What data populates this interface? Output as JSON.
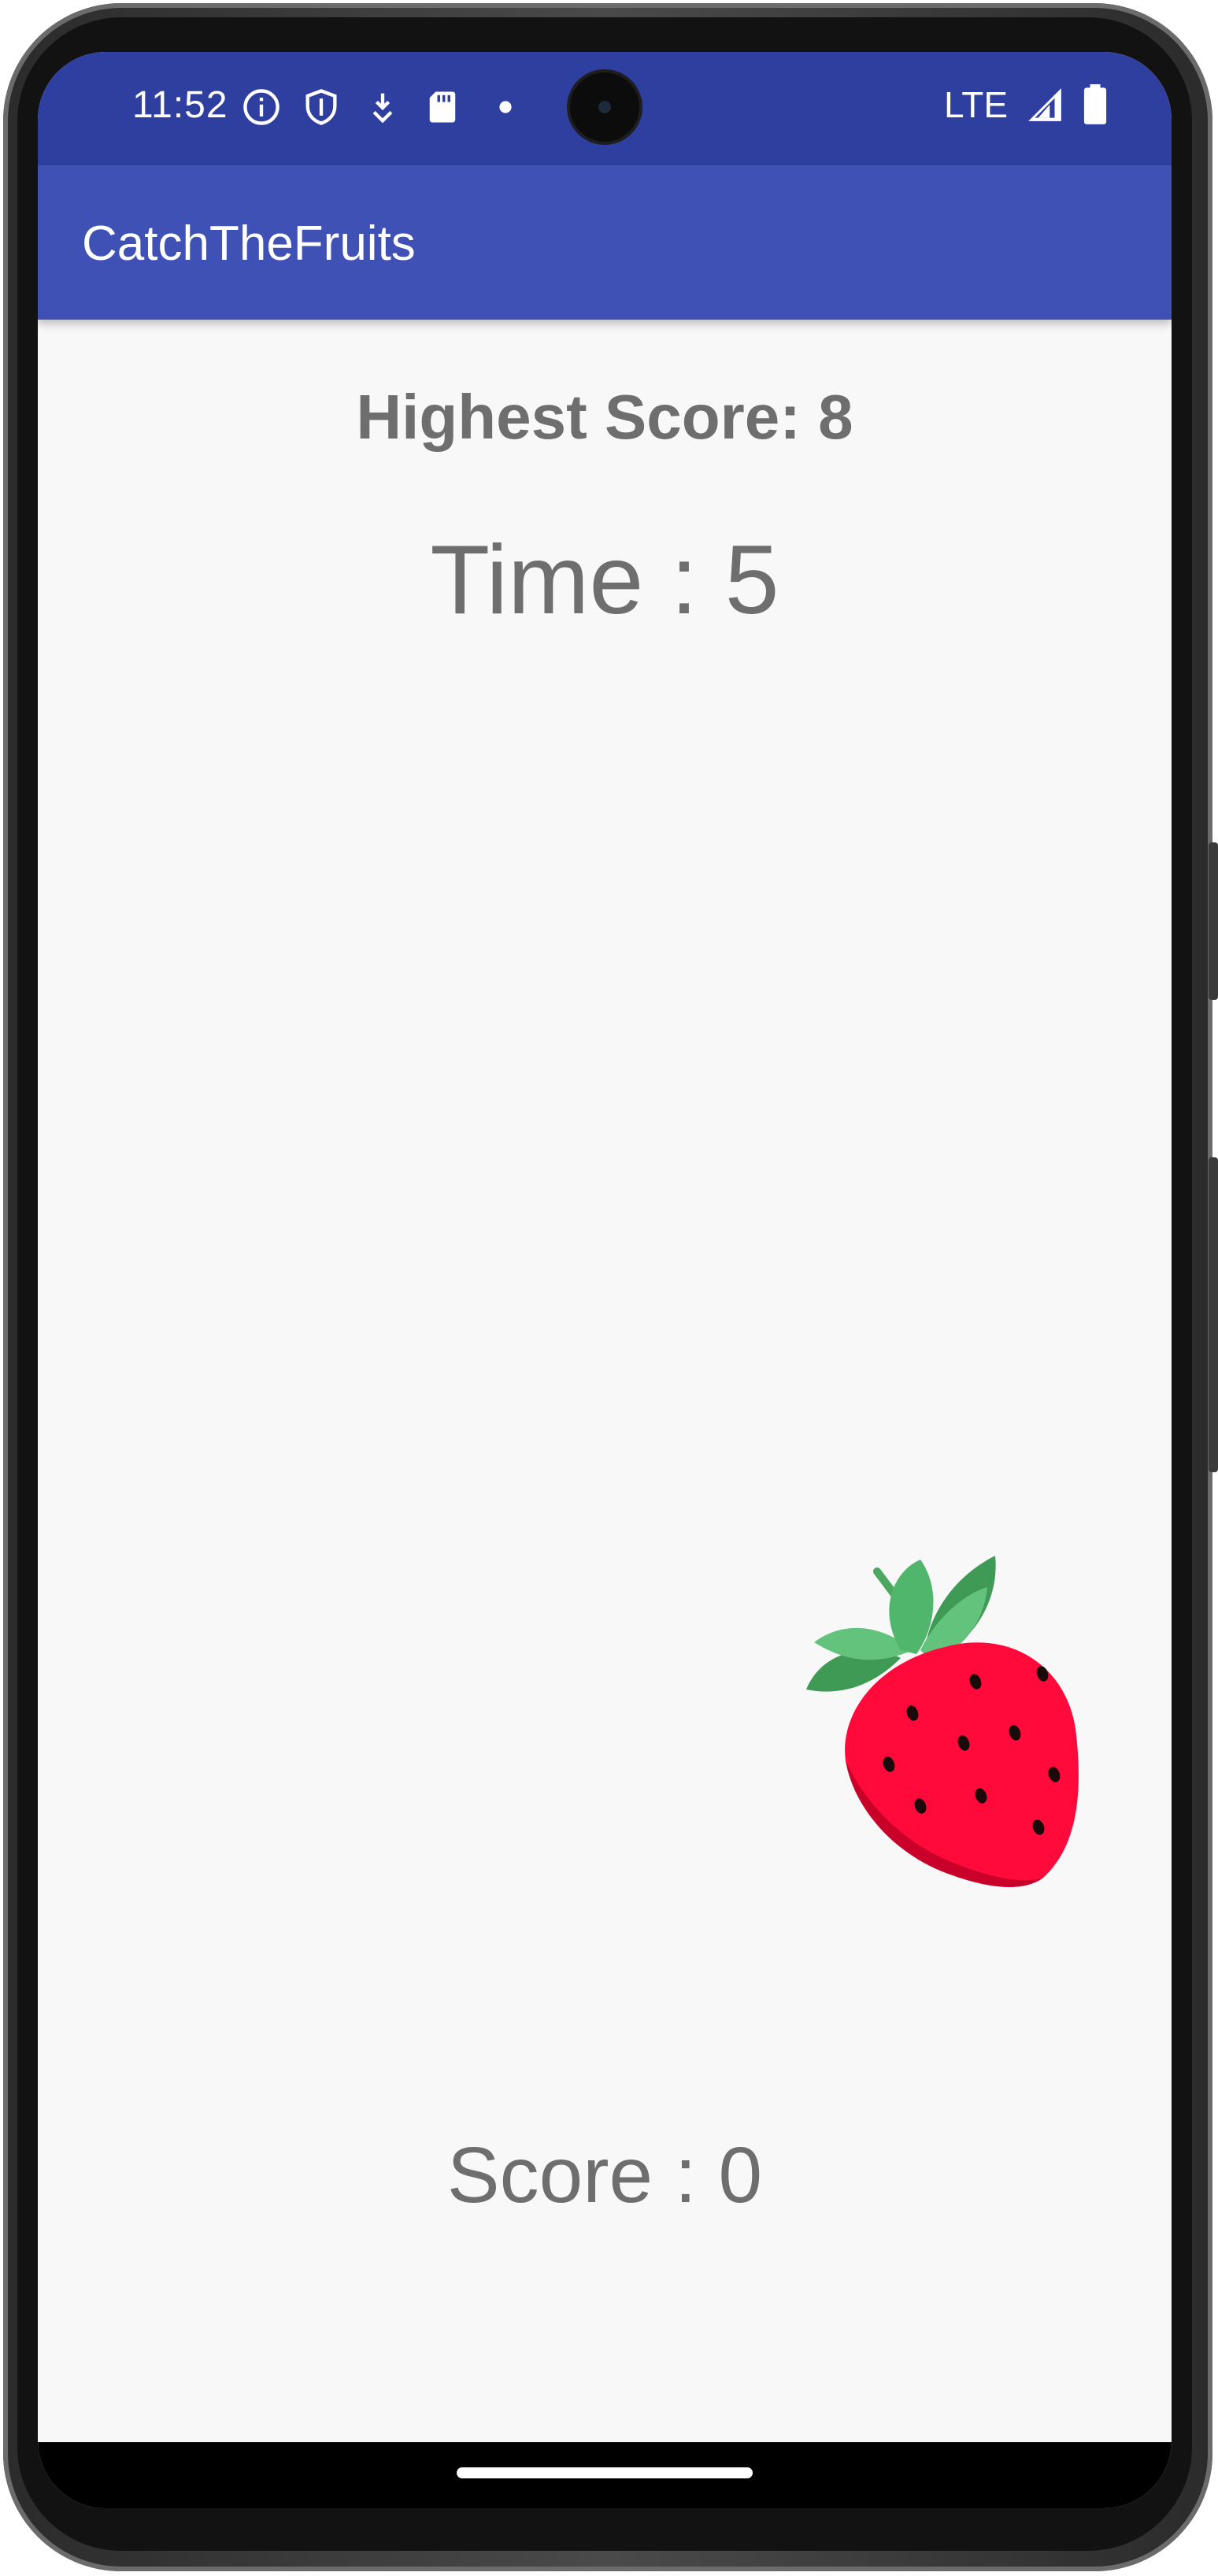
{
  "status_bar": {
    "time": "11:52",
    "network": "LTE",
    "icons": [
      "info-icon",
      "shield-icon",
      "download-icon",
      "sd-card-icon",
      "notification-dot-icon",
      "signal-icon",
      "battery-icon"
    ]
  },
  "app_bar": {
    "title": "CatchTheFruits"
  },
  "game": {
    "highest_score": "Highest Score: 8",
    "time": "Time : 5",
    "score": "Score : 0",
    "fruit": "strawberry-icon"
  },
  "colors": {
    "status_bar": "#2f3f9f",
    "app_bar": "#3f51b5",
    "text": "#6e6e6e",
    "background": "#f8f8f8"
  }
}
